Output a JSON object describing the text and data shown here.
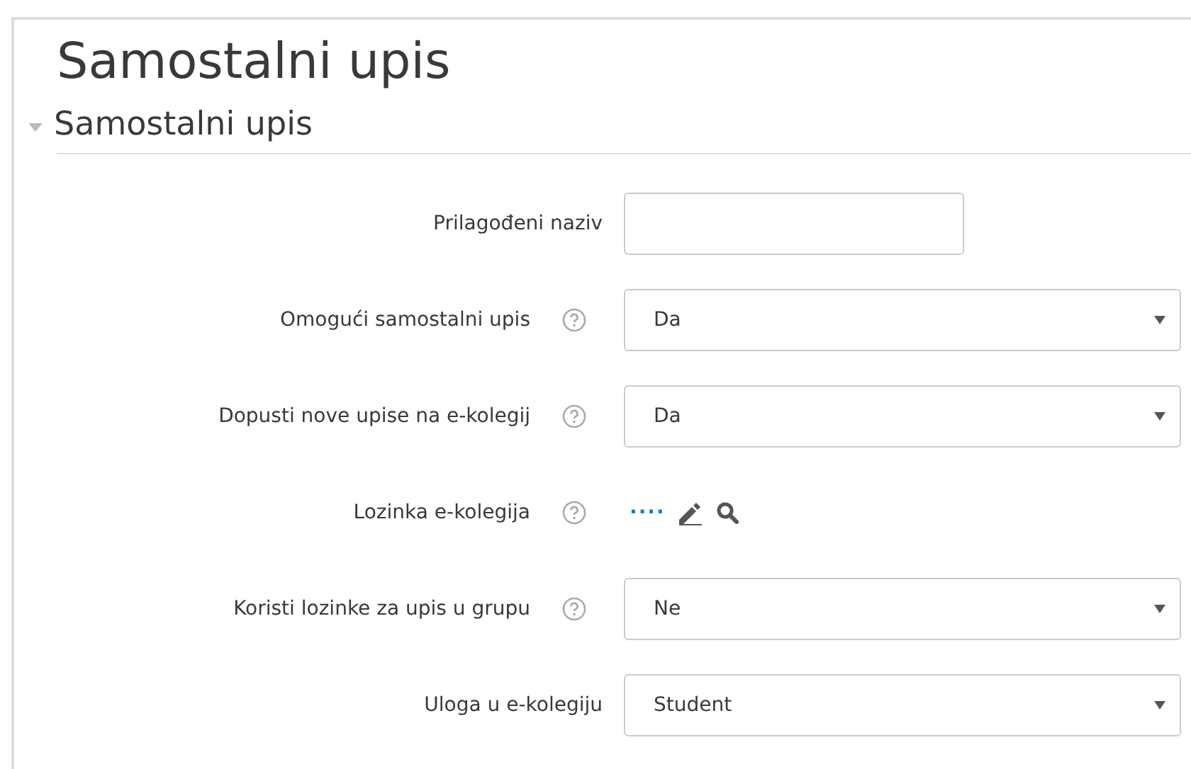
{
  "title": "Samostalni upis",
  "section": {
    "title": "Samostalni upis",
    "expanded": true
  },
  "rows": [
    {
      "label": "Prilagođeni naziv",
      "help": false,
      "kind": "text",
      "value": ""
    },
    {
      "label": "Omogući samostalni upis",
      "help": true,
      "kind": "select",
      "value": "Da"
    },
    {
      "label": "Dopusti nove upise na e-kolegij",
      "help": true,
      "kind": "select",
      "value": "Da"
    },
    {
      "label": "Lozinka e-kolegija",
      "help": true,
      "kind": "password",
      "value": "····"
    },
    {
      "label": "Koristi lozinke za upis u grupu",
      "help": true,
      "kind": "select",
      "value": "Ne"
    },
    {
      "label": "Uloga u e-kolegiju",
      "help": false,
      "kind": "select",
      "value": "Student"
    }
  ]
}
